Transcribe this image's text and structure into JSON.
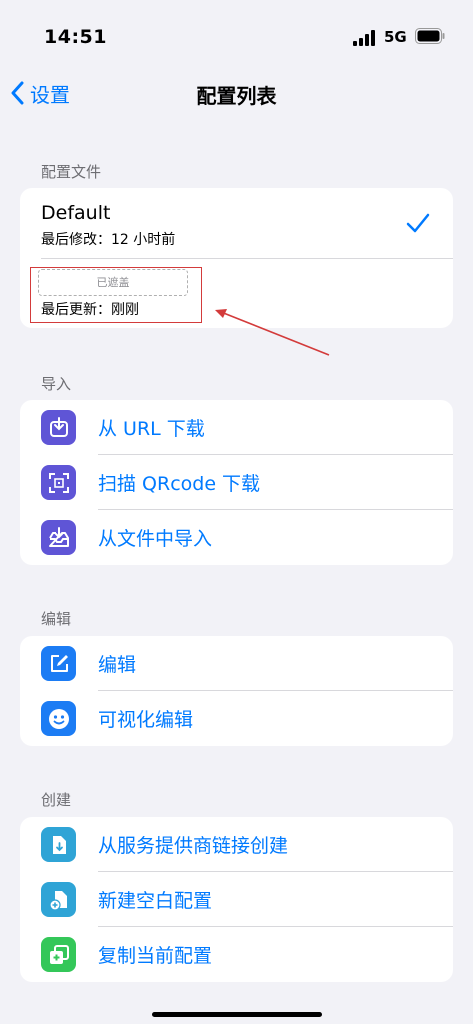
{
  "status": {
    "time": "14:51",
    "network": "5G"
  },
  "nav": {
    "back_label": "设置",
    "title": "配置列表"
  },
  "profiles": {
    "header": "配置文件",
    "default": {
      "name": "Default",
      "modified": "最后修改：12 小时前"
    },
    "remote": {
      "masked_label": "已遮盖",
      "updated": "最后更新：刚刚"
    }
  },
  "import": {
    "header": "导入",
    "items": [
      {
        "label": "从 URL 下载",
        "icon": "download-icon"
      },
      {
        "label": "扫描 QRcode 下载",
        "icon": "qrcode-scan-icon"
      },
      {
        "label": "从文件中导入",
        "icon": "inbox-import-icon"
      }
    ]
  },
  "edit": {
    "header": "编辑",
    "items": [
      {
        "label": "编辑",
        "icon": "edit-icon"
      },
      {
        "label": "可视化编辑",
        "icon": "smiley-icon"
      }
    ]
  },
  "create": {
    "header": "创建",
    "items": [
      {
        "label": "从服务提供商链接创建",
        "icon": "file-download-icon"
      },
      {
        "label": "新建空白配置",
        "icon": "file-add-icon"
      },
      {
        "label": "复制当前配置",
        "icon": "duplicate-icon"
      }
    ]
  },
  "colors": {
    "accent": "#007aff",
    "background": "#f2f2f7",
    "annotation": "#d33b3b",
    "import_icon": "#5f55d6",
    "edit_icon": "#1c7cf4",
    "create_icon_1": "#2fa4d6",
    "create_icon_2": "#2fa4d6",
    "create_icon_3": "#34c759"
  }
}
